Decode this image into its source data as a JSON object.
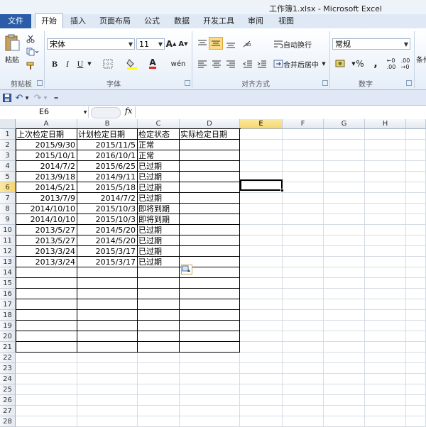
{
  "window": {
    "title": "工作簿1.xlsx - Microsoft Excel"
  },
  "tabs": [
    {
      "label": "文件"
    },
    {
      "label": "开始"
    },
    {
      "label": "插入"
    },
    {
      "label": "页面布局"
    },
    {
      "label": "公式"
    },
    {
      "label": "数据"
    },
    {
      "label": "开发工具"
    },
    {
      "label": "审阅"
    },
    {
      "label": "视图"
    }
  ],
  "ribbon": {
    "clipboard": {
      "paste": "粘贴",
      "label": "剪贴板"
    },
    "font": {
      "name": "宋体",
      "size": "11",
      "label": "字体",
      "bold": "B",
      "italic": "I",
      "underline": "U",
      "font_color_letter": "A",
      "phonetic": "wén"
    },
    "alignment": {
      "wrap": "自动换行",
      "merge": "合并后居中",
      "label": "对齐方式"
    },
    "number": {
      "format": "常规",
      "label": "数字",
      "percent": "%",
      "comma": ","
    },
    "styles": {
      "label_partial": "条件"
    }
  },
  "formula_bar": {
    "name_box": "E6",
    "fx": "fx"
  },
  "columns": [
    "A",
    "B",
    "C",
    "D",
    "E",
    "F",
    "G",
    "H"
  ],
  "rows": [
    "1",
    "2",
    "3",
    "4",
    "5",
    "6",
    "7",
    "8",
    "9",
    "10",
    "11",
    "12",
    "13",
    "14",
    "15",
    "16",
    "17",
    "18",
    "19",
    "20",
    "21",
    "22",
    "23",
    "24",
    "25",
    "26",
    "27",
    "28"
  ],
  "selected_cell": "E6",
  "table": {
    "headers": [
      "上次检定日期",
      "计划检定日期",
      "检定状态",
      "实际检定日期"
    ],
    "data": [
      [
        "2015/9/30",
        "2015/11/5",
        "正常",
        ""
      ],
      [
        "2015/10/1",
        "2016/10/1",
        "正常",
        ""
      ],
      [
        "2014/7/2",
        "2015/6/25",
        "已过期",
        ""
      ],
      [
        "2013/9/18",
        "2014/9/11",
        "已过期",
        ""
      ],
      [
        "2014/5/21",
        "2015/5/18",
        "已过期",
        ""
      ],
      [
        "2013/7/9",
        "2014/7/2",
        "已过期",
        ""
      ],
      [
        "2014/10/10",
        "2015/10/3",
        "即将到期",
        ""
      ],
      [
        "2014/10/10",
        "2015/10/3",
        "即将到期",
        ""
      ],
      [
        "2013/5/27",
        "2014/5/20",
        "已过期",
        ""
      ],
      [
        "2013/5/27",
        "2014/5/20",
        "已过期",
        ""
      ],
      [
        "2013/3/24",
        "2015/3/17",
        "已过期",
        ""
      ],
      [
        "2013/3/24",
        "2015/3/17",
        "已过期",
        ""
      ]
    ]
  }
}
